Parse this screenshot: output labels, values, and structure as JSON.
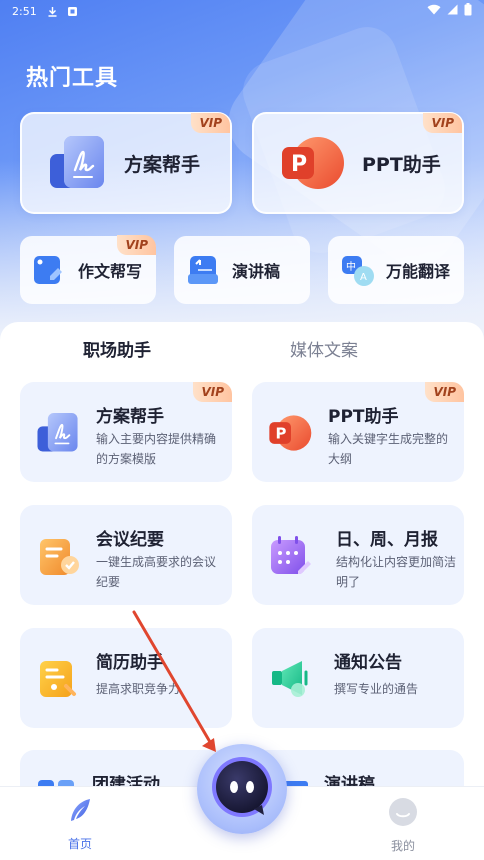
{
  "status_bar": {
    "time": "2:51"
  },
  "header": {
    "title": "热门工具"
  },
  "hot_tools": {
    "big": [
      {
        "label": "方案帮手",
        "badge": "VIP",
        "icon": "document-pen-icon"
      },
      {
        "label": "PPT助手",
        "badge": "VIP",
        "icon": "ppt-icon"
      }
    ],
    "small": [
      {
        "label": "作文帮写",
        "badge": "VIP",
        "icon": "essay-icon"
      },
      {
        "label": "演讲稿",
        "icon": "speech-icon"
      },
      {
        "label": "万能翻译",
        "icon": "translate-icon"
      }
    ]
  },
  "tabs": [
    {
      "label": "职场助手",
      "active": true
    },
    {
      "label": "媒体文案",
      "active": false
    }
  ],
  "features": [
    {
      "title": "方案帮手",
      "desc": "输入主要内容提供精确的方案模版",
      "badge": "VIP",
      "icon": "document-pen-icon"
    },
    {
      "title": "PPT助手",
      "desc": "输入关键字生成完整的大纲",
      "badge": "VIP",
      "icon": "ppt-icon"
    },
    {
      "title": "会议纪要",
      "desc": "一键生成高要求的会议纪要",
      "icon": "meeting-notes-icon"
    },
    {
      "title": "日、周、月报",
      "desc": "结构化让内容更加简洁明了",
      "icon": "calendar-icon"
    },
    {
      "title": "简历助手",
      "desc": "提高求职竞争力",
      "icon": "resume-icon"
    },
    {
      "title": "通知公告",
      "desc": "撰写专业的通告",
      "icon": "megaphone-icon"
    },
    {
      "title": "团建活动",
      "icon": "team-icon"
    },
    {
      "title": "演讲稿",
      "icon": "speech-icon"
    }
  ],
  "bottom_nav": [
    {
      "label": "首页",
      "active": true,
      "icon": "feather-icon"
    },
    {
      "label": "我的",
      "active": false,
      "icon": "profile-face-icon"
    }
  ],
  "colors": {
    "accent": "#4a72e8",
    "vip_bg": "#ffc4a0",
    "vip_text": "#a2421d",
    "card_bg": "#eef3fe",
    "arrow": "#e0462f"
  }
}
